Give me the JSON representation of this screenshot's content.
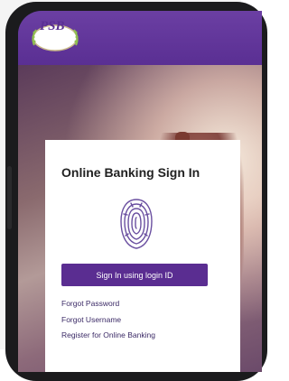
{
  "app": {
    "logo_text": "PSB"
  },
  "signin": {
    "title": "Online Banking Sign In",
    "login_button": "Sign In using login ID",
    "links": [
      "Forgot Password",
      "Forgot Username",
      "Register for Online Banking"
    ]
  },
  "colors": {
    "brand_purple": "#5a2d91",
    "header_purple": "#6b3fa3"
  },
  "icons": {
    "fingerprint": "fingerprint-icon",
    "logo": "psb-logo"
  }
}
